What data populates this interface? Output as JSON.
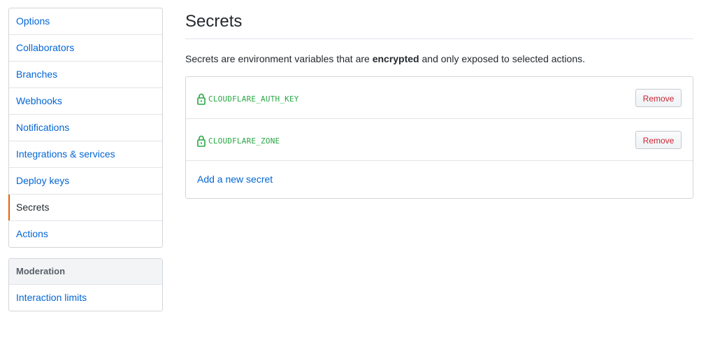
{
  "sidebar": {
    "items": [
      {
        "label": "Options"
      },
      {
        "label": "Collaborators"
      },
      {
        "label": "Branches"
      },
      {
        "label": "Webhooks"
      },
      {
        "label": "Notifications"
      },
      {
        "label": "Integrations & services"
      },
      {
        "label": "Deploy keys"
      },
      {
        "label": "Secrets",
        "selected": true
      },
      {
        "label": "Actions"
      }
    ],
    "moderation": {
      "heading": "Moderation",
      "items": [
        {
          "label": "Interaction limits"
        }
      ]
    }
  },
  "main": {
    "title": "Secrets",
    "intro": {
      "before": "Secrets are environment variables that are ",
      "bold": "encrypted",
      "after": " and only exposed to selected actions."
    },
    "secrets": [
      {
        "name": "CLOUDFLARE_AUTH_KEY",
        "action_label": "Remove"
      },
      {
        "name": "CLOUDFLARE_ZONE",
        "action_label": "Remove"
      }
    ],
    "add_label": "Add a new secret"
  },
  "colors": {
    "link": "#0366d6",
    "selected_indicator": "#e36209",
    "secret_name": "#28a745",
    "danger": "#cb2431"
  },
  "icons": {
    "secret": "lock-icon"
  }
}
